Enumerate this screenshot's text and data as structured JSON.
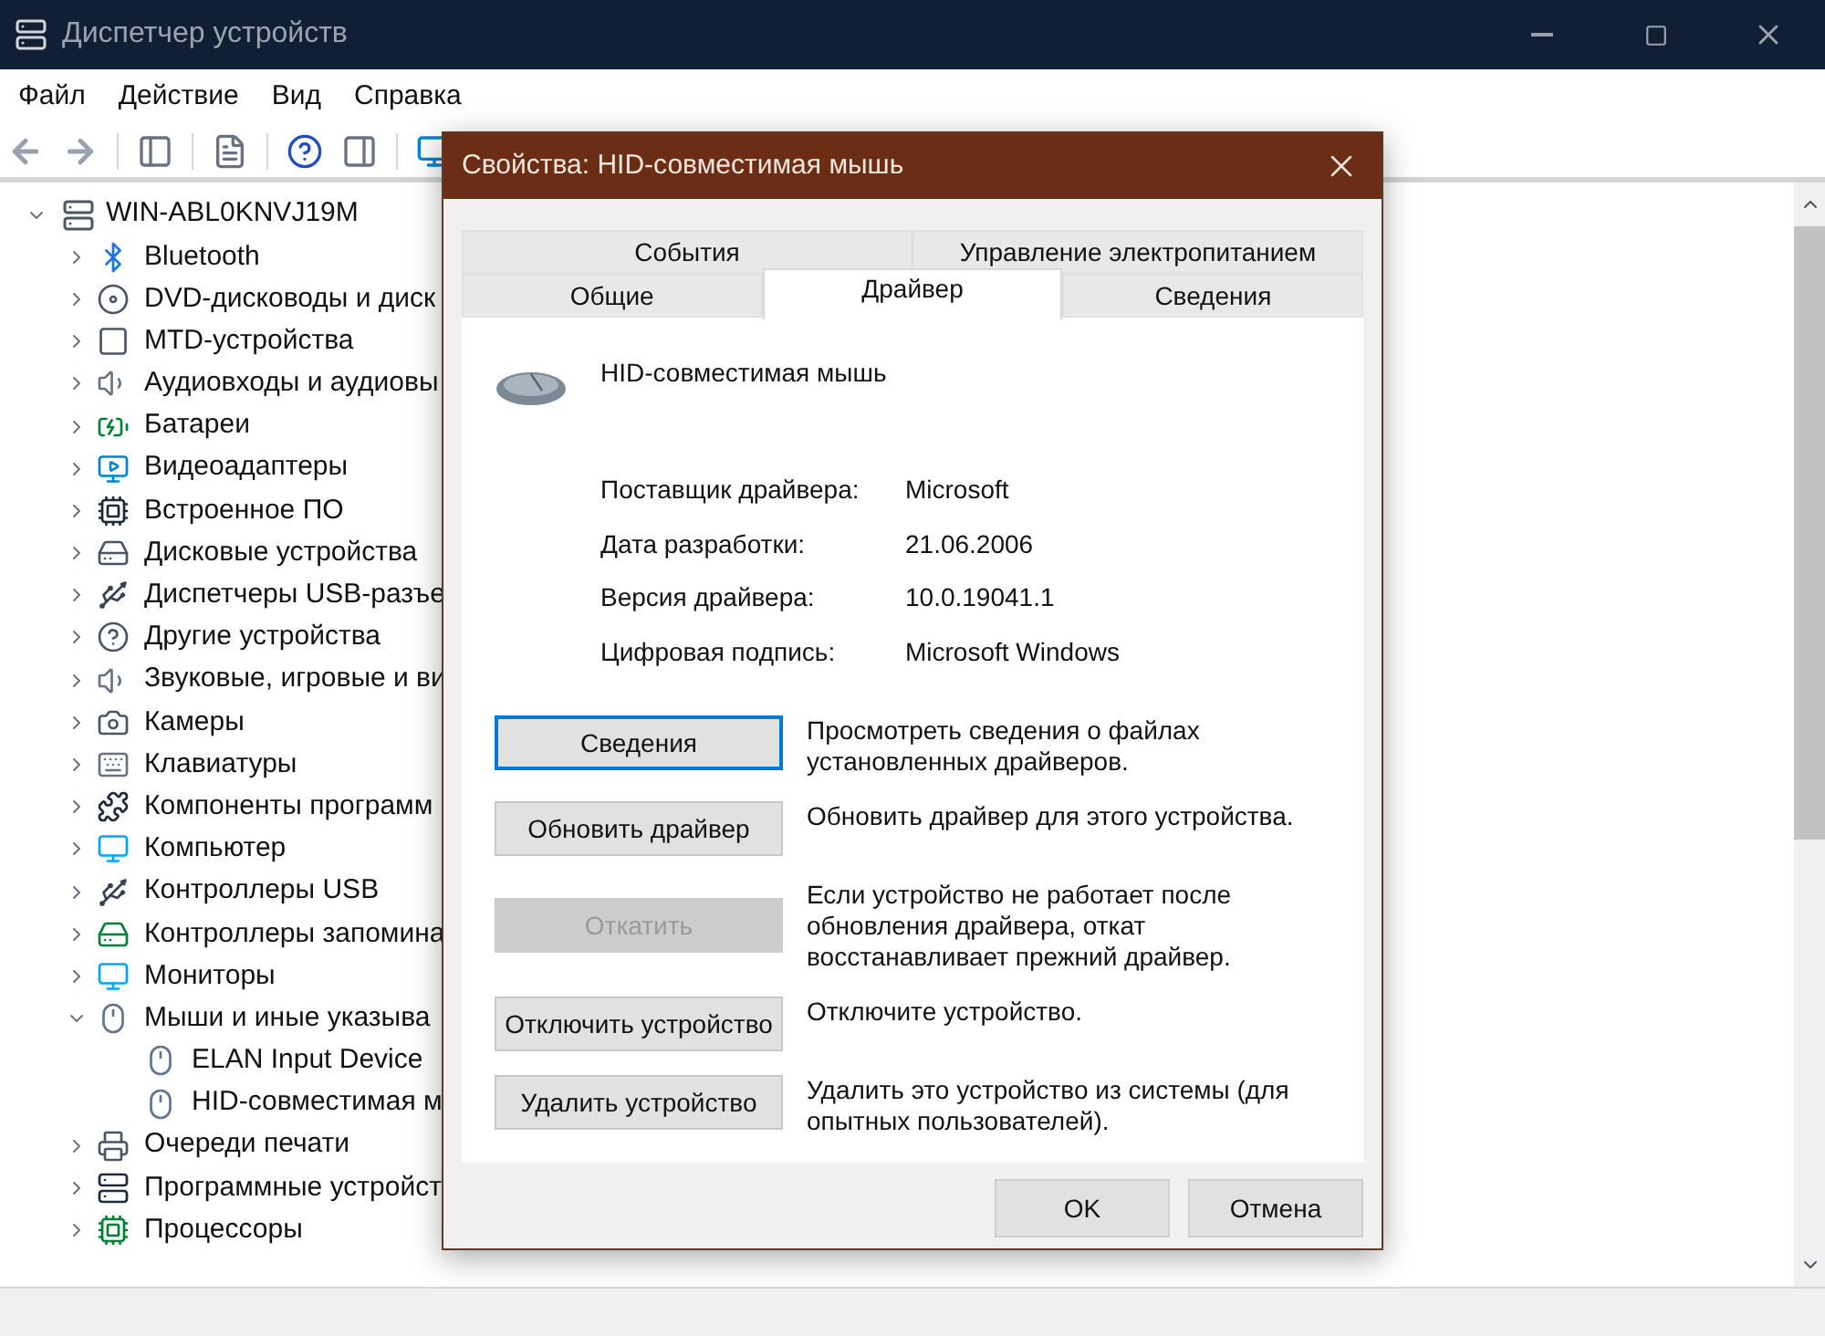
{
  "window": {
    "title": "Диспетчер устройств"
  },
  "menu": [
    "Файл",
    "Действие",
    "Вид",
    "Справка"
  ],
  "tree": {
    "label": "WIN-ABL0KNVJ19M",
    "expanded": true,
    "children": [
      {
        "label": "Bluetooth",
        "kind": "bluetooth",
        "expanded": false
      },
      {
        "label": "DVD-дисководы и диск",
        "kind": "disc",
        "expanded": false
      },
      {
        "label": "MTD-устройства",
        "kind": "frame",
        "expanded": false
      },
      {
        "label": "Аудиовходы и аудиовы",
        "kind": "speaker",
        "expanded": false
      },
      {
        "label": "Батареи",
        "kind": "battery",
        "expanded": false
      },
      {
        "label": "Видеоадаптеры",
        "kind": "display",
        "expanded": false
      },
      {
        "label": "Встроенное ПО",
        "kind": "chip",
        "expanded": false
      },
      {
        "label": "Дисковые устройства",
        "kind": "drive",
        "expanded": false
      },
      {
        "label": "Диспетчеры USB-разъе",
        "kind": "usb",
        "expanded": false
      },
      {
        "label": "Другие устройства",
        "kind": "unknown",
        "expanded": false
      },
      {
        "label": "Звуковые, игровые и ви",
        "kind": "speaker",
        "expanded": false
      },
      {
        "label": "Камеры",
        "kind": "camera",
        "expanded": false
      },
      {
        "label": "Клавиатуры",
        "kind": "keyboard",
        "expanded": false
      },
      {
        "label": "Компоненты программ",
        "kind": "component",
        "expanded": false
      },
      {
        "label": "Компьютер",
        "kind": "monitor",
        "expanded": false
      },
      {
        "label": "Контроллеры USB",
        "kind": "usb",
        "expanded": false
      },
      {
        "label": "Контроллеры запомина",
        "kind": "storage",
        "expanded": false
      },
      {
        "label": "Мониторы",
        "kind": "monitor",
        "expanded": false
      },
      {
        "label": "Мыши и иные указыва",
        "kind": "mouse",
        "expanded": true,
        "children": [
          {
            "label": "ELAN Input Device",
            "kind": "mouse"
          },
          {
            "label": "HID-совместимая м",
            "kind": "mouse"
          }
        ]
      },
      {
        "label": "Очереди печати",
        "kind": "printer",
        "expanded": false
      },
      {
        "label": "Программные устройст",
        "kind": "tower",
        "expanded": false
      },
      {
        "label": "Процессоры",
        "kind": "cpu",
        "expanded": false
      }
    ]
  },
  "dialog": {
    "title": "Свойства: HID-совместимая мышь",
    "tab_rows": [
      [
        {
          "label": "События",
          "selected": false
        },
        {
          "label": "Управление электропитанием",
          "selected": false
        }
      ],
      [
        {
          "label": "Общие",
          "selected": false
        },
        {
          "label": "Драйвер",
          "selected": true
        },
        {
          "label": "Сведения",
          "selected": false
        }
      ]
    ],
    "device_name": "HID-совместимая мышь",
    "properties": [
      {
        "label": "Поставщик драйвера:",
        "value": "Microsoft"
      },
      {
        "label": "Дата разработки:",
        "value": "21.06.2006"
      },
      {
        "label": "Версия драйвера:",
        "value": "10.0.19041.1"
      },
      {
        "label": "Цифровая подпись:",
        "value": "Microsoft Windows"
      }
    ],
    "actions": [
      {
        "button": "Сведения",
        "description": "Просмотреть сведения о файлах установленных драйверов.",
        "disabled": false,
        "focused": true
      },
      {
        "button": "Обновить драйвер",
        "description": "Обновить драйвер для этого устройства.",
        "disabled": false,
        "focused": false
      },
      {
        "button": "Откатить",
        "description": "Если устройство не работает после обновления драйвера, откат восстанавливает прежний драйвер.",
        "disabled": true,
        "focused": false
      },
      {
        "button": "Отключить устройство",
        "description": "Отключите устройство.",
        "disabled": false,
        "focused": false
      },
      {
        "button": "Удалить устройство",
        "description": "Удалить это устройство из системы (для опытных пользователей).",
        "disabled": false,
        "focused": false
      }
    ],
    "buttons": [
      "OK",
      "Отмена"
    ]
  }
}
